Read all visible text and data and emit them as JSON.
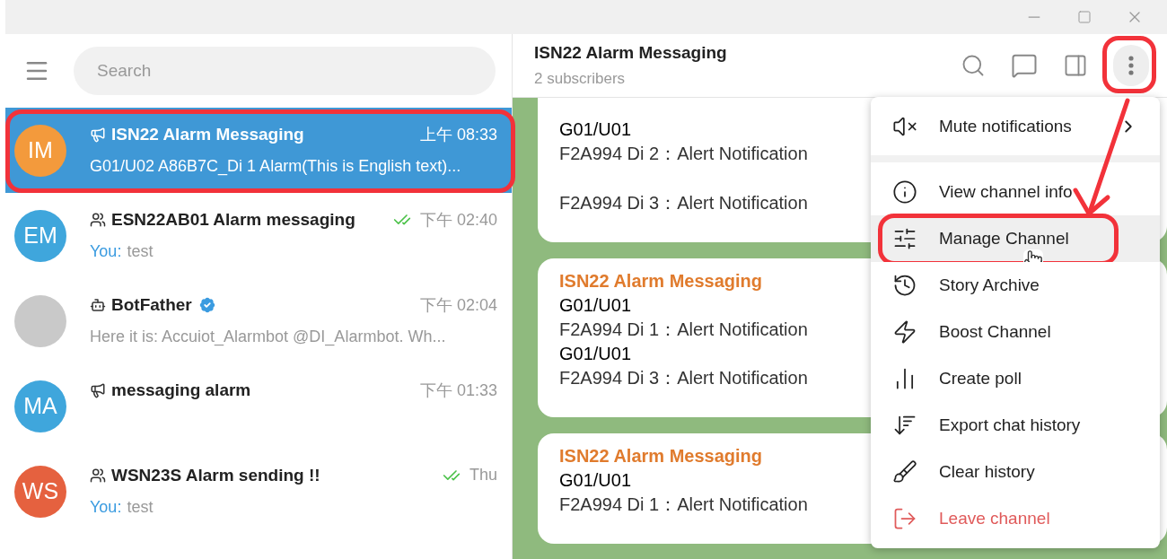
{
  "search": {
    "placeholder": "Search"
  },
  "chats": [
    {
      "initials": "IM",
      "color": "#f39a3c",
      "kind": "channel",
      "name": "ISN22 Alarm Messaging",
      "verified": false,
      "time": "上午 08:33",
      "read": false,
      "preview": "G01/U02 A86B7C_Di 1 Alarm(This is English text)...",
      "selected": true,
      "highlighted": true
    },
    {
      "initials": "EM",
      "color": "#3fa6dc",
      "kind": "group",
      "name": "ESN22AB01 Alarm messaging",
      "verified": false,
      "time": "下午 02:40",
      "read": true,
      "sender": "You:",
      "preview": "test",
      "selected": false,
      "highlighted": false
    },
    {
      "kind": "bot",
      "name": "BotFather",
      "verified": true,
      "time": "下午 02:04",
      "read": false,
      "preview": "Here it is: Accuiot_Alarmbot @DI_Alarmbot. Wh...",
      "selected": false,
      "highlighted": false
    },
    {
      "initials": "MA",
      "color": "#3fa6dc",
      "kind": "channel",
      "name": "messaging alarm",
      "verified": false,
      "time": "下午 01:33",
      "read": false,
      "selected": false,
      "highlighted": false
    },
    {
      "initials": "WS",
      "color": "#e5613f",
      "kind": "group",
      "name": "WSN23S Alarm sending !!",
      "verified": false,
      "time": "Thu",
      "read": true,
      "sender": "You:",
      "preview": "test",
      "selected": false,
      "highlighted": false
    }
  ],
  "chat_header": {
    "title": "ISN22 Alarm Messaging",
    "subtitle": "2 subscribers",
    "more_highlighted": true
  },
  "messages": [
    {
      "lines": [
        {
          "kind": "plain",
          "text": "G01/U01"
        },
        {
          "kind": "alert",
          "text": "F2A994 Di 2：Alert Notification"
        },
        {
          "kind": "alert",
          "text": "F2A994 Di 3：Alert Notification",
          "spaced": true
        }
      ]
    },
    {
      "lines": [
        {
          "kind": "sender",
          "text": "ISN22 Alarm Messaging"
        },
        {
          "kind": "plain",
          "text": "G01/U01"
        },
        {
          "kind": "alert",
          "text": "F2A994 Di 1：Alert Notification"
        },
        {
          "kind": "plain",
          "text": "G01/U01"
        },
        {
          "kind": "alert",
          "text": "F2A994 Di 3：Alert Notification"
        }
      ]
    },
    {
      "lines": [
        {
          "kind": "sender",
          "text": "ISN22 Alarm Messaging"
        },
        {
          "kind": "plain",
          "text": "G01/U01"
        },
        {
          "kind": "alert",
          "text": "F2A994 Di 1：Alert Notification"
        }
      ]
    }
  ],
  "menu": [
    {
      "kind": "submenu",
      "label": "Mute notifications",
      "hovered": false,
      "highlighted": false
    },
    {
      "kind": "normal",
      "label": "View channel info",
      "hovered": false,
      "highlighted": false
    },
    {
      "kind": "normal",
      "label": "Manage Channel",
      "hovered": true,
      "highlighted": true
    },
    {
      "kind": "normal",
      "label": "Story Archive",
      "hovered": false,
      "highlighted": false
    },
    {
      "kind": "normal",
      "label": "Boost Channel",
      "hovered": false,
      "highlighted": false
    },
    {
      "kind": "normal",
      "label": "Create poll",
      "hovered": false,
      "highlighted": false
    },
    {
      "kind": "normal",
      "label": "Export chat history",
      "hovered": false,
      "highlighted": false
    },
    {
      "kind": "normal",
      "label": "Clear history",
      "hovered": false,
      "highlighted": false
    },
    {
      "kind": "danger",
      "label": "Leave channel",
      "hovered": false,
      "highlighted": false
    }
  ]
}
